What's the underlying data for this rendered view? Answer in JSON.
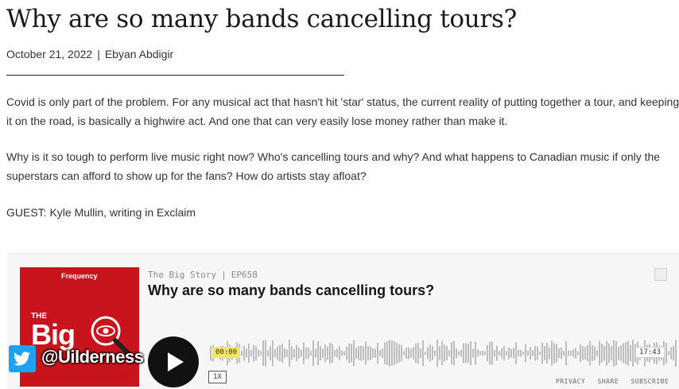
{
  "article": {
    "title": "Why are so many bands cancelling tours?",
    "date": "October 21, 2022",
    "separator": "|",
    "author": "Ebyan Abdigir",
    "paragraphs": [
      "Covid is only part of the problem. For any musical act that hasn't hit 'star' status, the current reality of putting together a tour, and keeping it on the road, is basically a highwire act. And one that can very easily lose money rather than make it.",
      "Why is it so tough to perform live music right now? Who's cancelling tours and why? And what happens to Canadian music if only the superstars can afford to show up for the fans? How do artists stay afloat?",
      "GUEST: Kyle Mullin, writing in Exclaim"
    ]
  },
  "player": {
    "cover": {
      "brand": "Frequency",
      "line1": "THE",
      "line2": "Big"
    },
    "show": "The Big Story",
    "pipe": "|",
    "episode": "EP658",
    "episode_title": "Why are so many bands cancelling tours?",
    "current_time": "00:00",
    "total_time": "17:43",
    "speed": "1X",
    "footer_links": [
      "PRIVACY",
      "SHARE",
      "SUBSCRIBE"
    ],
    "colors": {
      "cover": "#c8151d",
      "time_highlight": "#f1e85a"
    }
  },
  "overlay": {
    "handle": "@Uilderness",
    "icon": "twitter-bird-icon",
    "color": "#1da1f2"
  }
}
